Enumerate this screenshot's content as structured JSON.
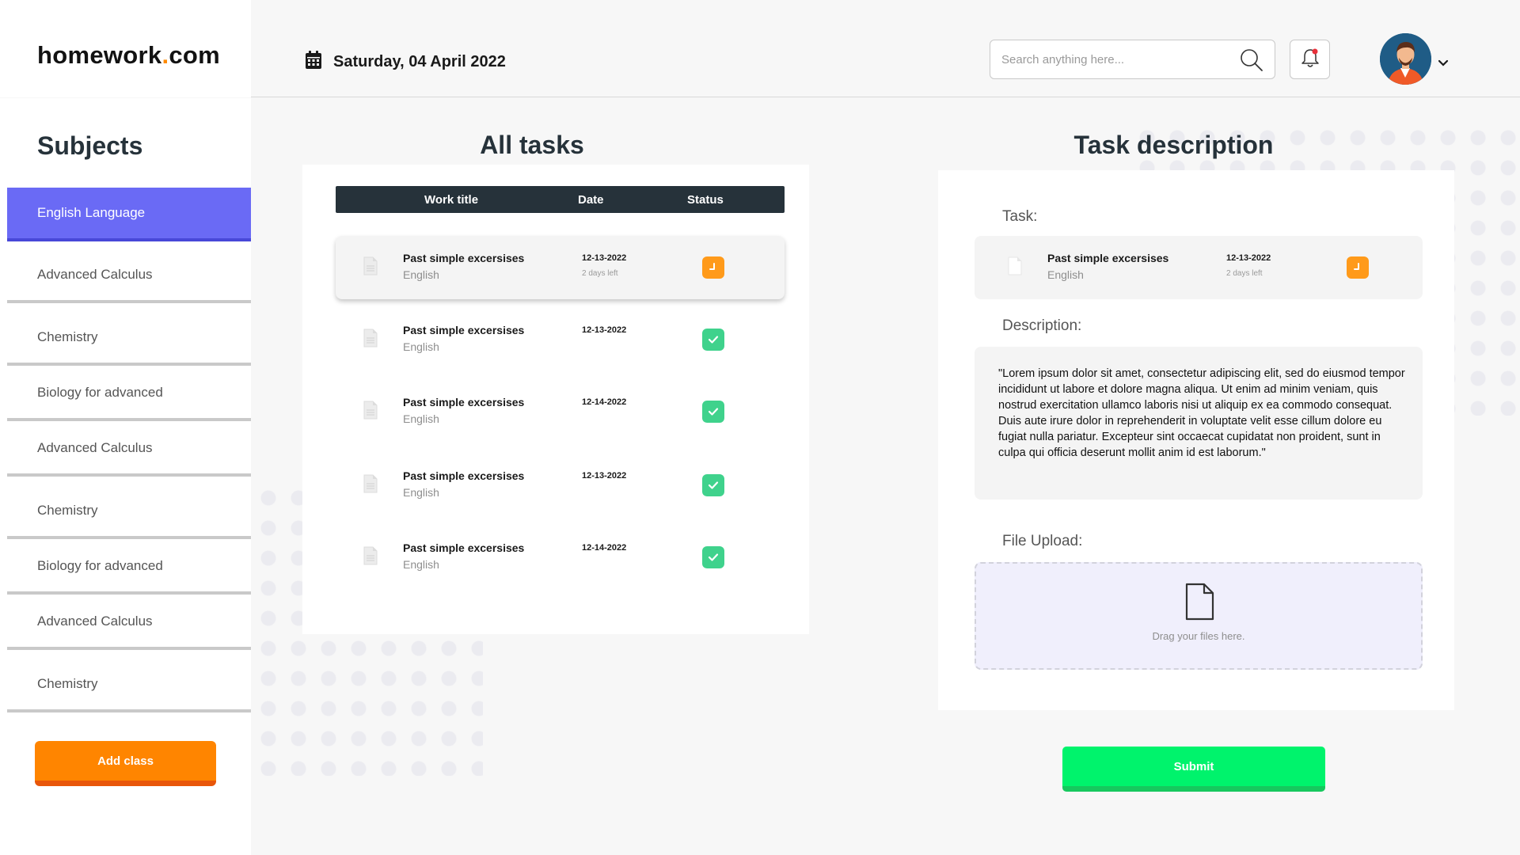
{
  "brand": {
    "name": "homework",
    "dot": ".",
    "tld": "com"
  },
  "header": {
    "date": "Saturday, 04 April 2022",
    "search_placeholder": "Search anything here..."
  },
  "sidebar": {
    "title": "Subjects",
    "items": [
      {
        "label": "English Language",
        "active": true
      },
      {
        "label": "Advanced Calculus",
        "active": false
      },
      {
        "label": "Chemistry",
        "active": false
      },
      {
        "label": "Biology for advanced",
        "active": false
      },
      {
        "label": "Advanced Calculus",
        "active": false
      },
      {
        "label": "Chemistry",
        "active": false
      },
      {
        "label": "Biology for advanced",
        "active": false
      },
      {
        "label": "Advanced Calculus",
        "active": false
      },
      {
        "label": "Chemistry",
        "active": false
      }
    ],
    "add_button": "Add class"
  },
  "tasks": {
    "title": "All tasks",
    "columns": [
      "Work title",
      "Date",
      "Status"
    ],
    "rows": [
      {
        "title": "Past simple excersises",
        "subject": "English",
        "date": "12-13-2022",
        "left": "2 days left",
        "status": "pending"
      },
      {
        "title": "Past simple excersises",
        "subject": "English",
        "date": "12-13-2022",
        "left": "",
        "status": "done"
      },
      {
        "title": "Past simple excersises",
        "subject": "English",
        "date": "12-14-2022",
        "left": "",
        "status": "done"
      },
      {
        "title": "Past simple excersises",
        "subject": "English",
        "date": "12-13-2022",
        "left": "",
        "status": "done"
      },
      {
        "title": "Past simple excersises",
        "subject": "English",
        "date": "12-14-2022",
        "left": "",
        "status": "done"
      }
    ]
  },
  "description": {
    "title": "Task description",
    "task_label": "Task:",
    "task": {
      "title": "Past simple excersises",
      "subject": "English",
      "date": "12-13-2022",
      "left": "2 days left",
      "status": "pending"
    },
    "desc_label": "Description:",
    "desc_text": "\"Lorem ipsum dolor sit amet, consectetur adipiscing elit, sed do eiusmod tempor incididunt ut labore et dolore magna aliqua. Ut enim ad minim veniam, quis nostrud exercitation ullamco laboris nisi ut aliquip ex ea commodo consequat. Duis aute irure dolor in reprehenderit in voluptate velit esse cillum dolore eu fugiat nulla pariatur. Excepteur sint occaecat cupidatat non proident, sunt in culpa qui officia deserunt mollit anim id est laborum.\"",
    "upload_label": "File Upload:",
    "upload_hint": "Drag your files here.",
    "submit": "Submit"
  },
  "colors": {
    "accent_purple": "#6a6af5",
    "add_orange": "#ff8500",
    "submit_green": "#00f36c",
    "status_pending": "#ff9a1a",
    "status_done": "#3fd28c",
    "dark": "#26323a"
  },
  "icons": {
    "calendar": "calendar-icon",
    "search": "search-icon",
    "bell": "bell-icon",
    "chevron": "chevron-down-icon",
    "document": "document-icon",
    "pending": "clock-icon",
    "done": "check-icon",
    "upload": "file-icon"
  }
}
